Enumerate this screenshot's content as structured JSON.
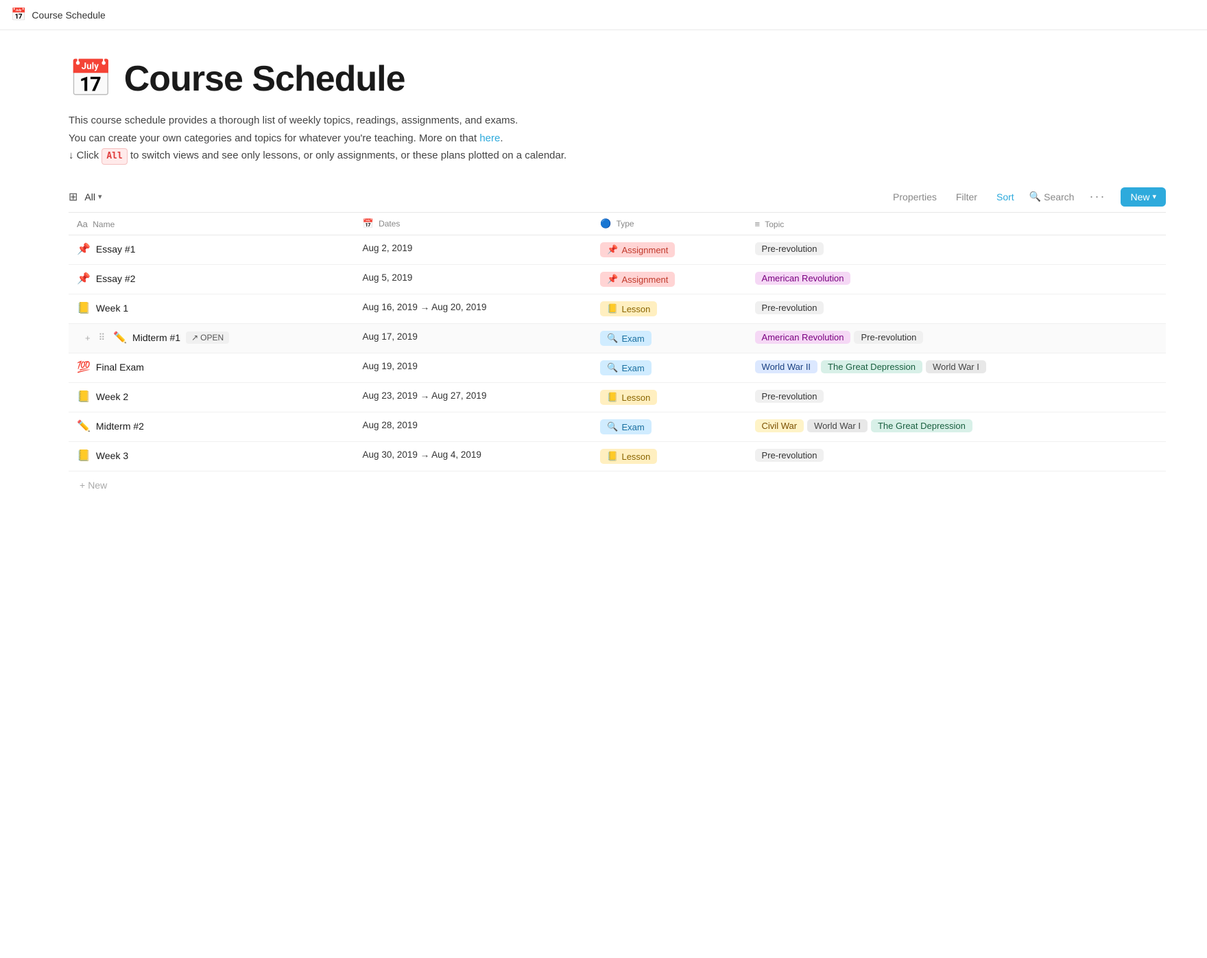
{
  "topBar": {
    "icon": "📅",
    "title": "Course Schedule"
  },
  "page": {
    "icon": "📅",
    "title": "Course Schedule",
    "description1": "This course schedule provides a thorough list of weekly topics, readings, assignments, and exams.",
    "description2": "You can create your own categories and topics for whatever you're teaching. More on that",
    "hereLink": "here",
    "description3": ".",
    "description4Arrow": "↓ Click",
    "allBadge": "All",
    "description4Rest": "to switch views and see only lessons, or only assignments, or these plans plotted on a calendar."
  },
  "toolbar": {
    "gridIcon": "▦",
    "allLabel": "All",
    "propertiesLabel": "Properties",
    "filterLabel": "Filter",
    "sortLabel": "Sort",
    "searchIcon": "🔍",
    "searchLabel": "Search",
    "dotsLabel": "···",
    "newLabel": "New"
  },
  "columns": [
    {
      "id": "name",
      "icon": "Aa",
      "label": "Name"
    },
    {
      "id": "dates",
      "icon": "📅",
      "label": "Dates"
    },
    {
      "id": "type",
      "icon": "🔵",
      "label": "Type"
    },
    {
      "id": "topic",
      "icon": "≡",
      "label": "Topic"
    }
  ],
  "rows": [
    {
      "id": "essay1",
      "nameEmoji": "📌",
      "name": "Essay #1",
      "date": "Aug 2, 2019",
      "typeClass": "type-assignment",
      "typeIcon": "📌",
      "typeLabel": "Assignment",
      "topics": [
        {
          "label": "Pre-revolution",
          "class": "topic-pre-revolution"
        }
      ]
    },
    {
      "id": "essay2",
      "nameEmoji": "📌",
      "name": "Essay #2",
      "date": "Aug 5, 2019",
      "typeClass": "type-assignment",
      "typeIcon": "📌",
      "typeLabel": "Assignment",
      "topics": [
        {
          "label": "American Revolution",
          "class": "topic-american-revolution"
        }
      ]
    },
    {
      "id": "week1",
      "nameEmoji": "📒",
      "name": "Week 1",
      "date": "Aug 16, 2019 → Aug 20, 2019",
      "typeClass": "type-lesson",
      "typeIcon": "📒",
      "typeLabel": "Lesson",
      "topics": [
        {
          "label": "Pre-revolution",
          "class": "topic-pre-revolution"
        }
      ]
    },
    {
      "id": "midterm1",
      "nameEmoji": "✏️",
      "name": "Midterm #1",
      "date": "Aug 17, 2019",
      "typeClass": "type-exam",
      "typeIcon": "🔍",
      "typeLabel": "Exam",
      "hovered": true,
      "topics": [
        {
          "label": "American Revolution",
          "class": "topic-american-revolution"
        },
        {
          "label": "Pre-revolution",
          "class": "topic-pre-revolution"
        }
      ]
    },
    {
      "id": "finalexam",
      "nameEmoji": "💯",
      "name": "Final Exam",
      "date": "Aug 19, 2019",
      "typeClass": "type-exam",
      "typeIcon": "🔍",
      "typeLabel": "Exam",
      "topics": [
        {
          "label": "World War II",
          "class": "topic-world-war-ii"
        },
        {
          "label": "The Great Depression",
          "class": "topic-great-depression"
        },
        {
          "label": "World War I",
          "class": "topic-world-war-i"
        }
      ]
    },
    {
      "id": "week2",
      "nameEmoji": "📒",
      "name": "Week 2",
      "date": "Aug 23, 2019 → Aug 27, 2019",
      "typeClass": "type-lesson",
      "typeIcon": "📒",
      "typeLabel": "Lesson",
      "topics": [
        {
          "label": "Pre-revolution",
          "class": "topic-pre-revolution"
        }
      ]
    },
    {
      "id": "midterm2",
      "nameEmoji": "✏️",
      "name": "Midterm #2",
      "date": "Aug 28, 2019",
      "typeClass": "type-exam",
      "typeIcon": "🔍",
      "typeLabel": "Exam",
      "topics": [
        {
          "label": "Civil War",
          "class": "topic-civil-war"
        },
        {
          "label": "World War I",
          "class": "topic-world-war-i"
        },
        {
          "label": "The Great Depression",
          "class": "topic-great-depression"
        }
      ]
    },
    {
      "id": "week3",
      "nameEmoji": "📒",
      "name": "Week 3",
      "date": "Aug 30, 2019 → Aug 4, 2019",
      "typeClass": "type-lesson",
      "typeIcon": "📒",
      "typeLabel": "Lesson",
      "topics": [
        {
          "label": "Pre-revolution",
          "class": "topic-pre-revolution"
        }
      ]
    }
  ],
  "addNew": {
    "label": "+ New"
  }
}
